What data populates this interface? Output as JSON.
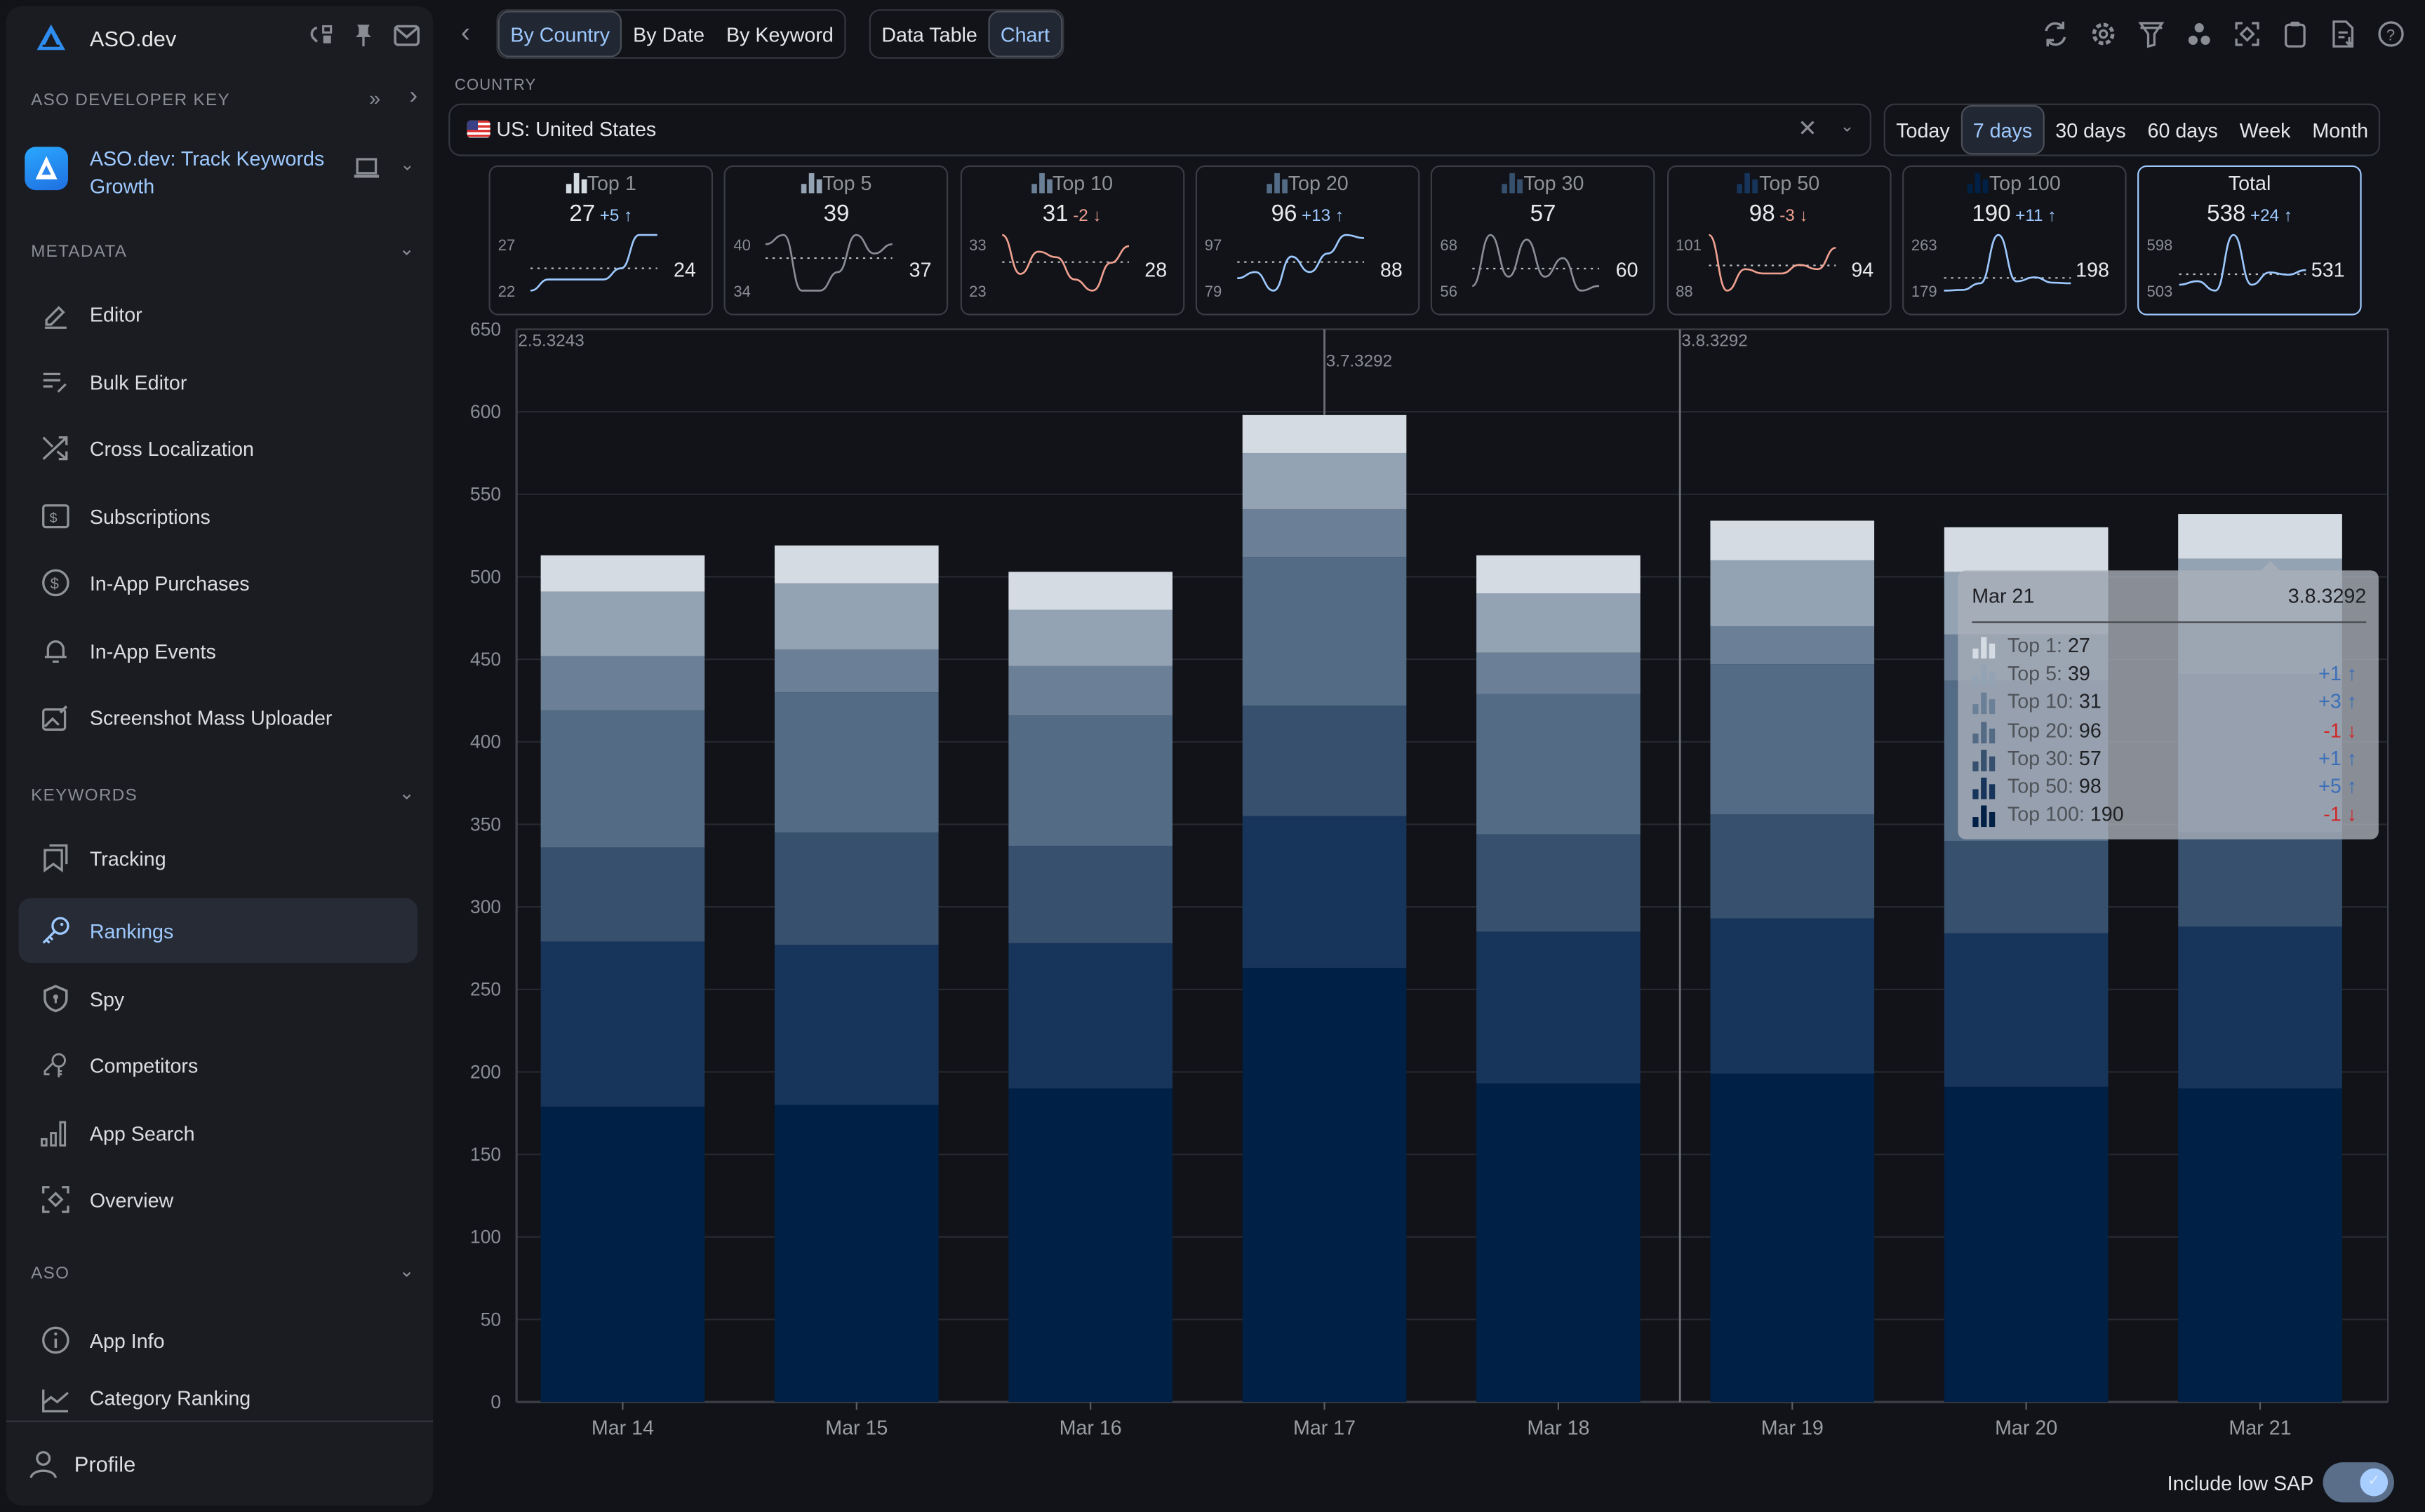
{
  "sidebar": {
    "brand": "ASO.dev",
    "developer_key_label": "ASO DEVELOPER KEY",
    "app_name": "ASO.dev: Track Keywords Growth",
    "sections": [
      {
        "label": "METADATA",
        "items": [
          {
            "label": "Editor",
            "icon": "pencil-icon"
          },
          {
            "label": "Bulk Editor",
            "icon": "bulk-edit-icon"
          },
          {
            "label": "Cross Localization",
            "icon": "shuffle-icon"
          },
          {
            "label": "Subscriptions",
            "icon": "subscription-icon"
          },
          {
            "label": "In-App Purchases",
            "icon": "dollar-circle-icon"
          },
          {
            "label": "In-App Events",
            "icon": "bell-icon"
          },
          {
            "label": "Screenshot Mass Uploader",
            "icon": "image-edit-icon"
          }
        ]
      },
      {
        "label": "KEYWORDS",
        "items": [
          {
            "label": "Tracking",
            "icon": "bookmarks-icon"
          },
          {
            "label": "Rankings",
            "icon": "key-icon",
            "active": true
          },
          {
            "label": "Spy",
            "icon": "shield-lock-icon"
          },
          {
            "label": "Competitors",
            "icon": "keys-icon"
          },
          {
            "label": "App Search",
            "icon": "bar-chart-icon"
          },
          {
            "label": "Overview",
            "icon": "focus-icon"
          }
        ]
      },
      {
        "label": "ASO",
        "items": [
          {
            "label": "App Info",
            "icon": "info-icon"
          },
          {
            "label": "Category Ranking",
            "icon": "trend-icon"
          }
        ]
      }
    ],
    "profile_label": "Profile"
  },
  "toolbar": {
    "group_tabs": [
      {
        "label": "By Country",
        "selected": true
      },
      {
        "label": "By Date",
        "selected": false
      },
      {
        "label": "By Keyword",
        "selected": false
      }
    ],
    "view_tabs": [
      {
        "label": "Data Table",
        "selected": false
      },
      {
        "label": "Chart",
        "selected": true
      }
    ],
    "icons": [
      "refresh-icon",
      "settings-icon",
      "filter-icon",
      "cluster-icon",
      "focus-icon",
      "clipboard-icon",
      "export-icon",
      "help-icon"
    ]
  },
  "country": {
    "label": "COUNTRY",
    "value": "US: United States"
  },
  "ranges": [
    {
      "label": "Today",
      "selected": false
    },
    {
      "label": "7 days",
      "selected": true
    },
    {
      "label": "30 days",
      "selected": false
    },
    {
      "label": "60 days",
      "selected": false
    },
    {
      "label": "Week",
      "selected": false
    },
    {
      "label": "Month",
      "selected": false
    }
  ],
  "cards": [
    {
      "title": "Top 1",
      "value": "27",
      "delta": "+5 ↑",
      "dir": "up",
      "max": "27",
      "min": "22",
      "avg": "24",
      "color": "#d4dbe2",
      "trend": [
        22,
        23,
        23,
        23,
        23,
        24,
        27,
        27
      ]
    },
    {
      "title": "Top 5",
      "value": "39",
      "delta": "",
      "dir": "flat",
      "max": "40",
      "min": "34",
      "avg": "37",
      "color": "#94a3b4",
      "trend": [
        39,
        40,
        34,
        34,
        36,
        40,
        38,
        39
      ]
    },
    {
      "title": "Top 10",
      "value": "31",
      "delta": "-2 ↓",
      "dir": "down",
      "max": "33",
      "min": "23",
      "avg": "28",
      "color": "#6b8097",
      "trend": [
        33,
        26,
        30,
        29,
        25,
        23,
        28,
        31
      ]
    },
    {
      "title": "Top 20",
      "value": "96",
      "delta": "+13 ↑",
      "dir": "up",
      "max": "97",
      "min": "79",
      "avg": "88",
      "color": "#546b85",
      "trend": [
        83,
        85,
        79,
        90,
        85,
        91,
        97,
        96
      ]
    },
    {
      "title": "Top 30",
      "value": "57",
      "delta": "",
      "dir": "flat",
      "max": "68",
      "min": "56",
      "avg": "60",
      "color": "#36506e",
      "trend": [
        57,
        68,
        59,
        67,
        59,
        63,
        56,
        57
      ]
    },
    {
      "title": "Top 50",
      "value": "98",
      "delta": "-3 ↓",
      "dir": "down",
      "max": "101",
      "min": "88",
      "avg": "94",
      "color": "#17345a",
      "trend": [
        101,
        88,
        93,
        92,
        92,
        94,
        93,
        98
      ]
    },
    {
      "title": "Top 100",
      "value": "190",
      "delta": "+11 ↑",
      "dir": "up",
      "max": "263",
      "min": "179",
      "avg": "198",
      "color": "#002046",
      "trend": [
        179,
        180,
        190,
        263,
        193,
        199,
        191,
        190
      ]
    },
    {
      "title": "Total",
      "value": "538",
      "delta": "+24 ↑",
      "dir": "up",
      "max": "598",
      "min": "503",
      "avg": "531",
      "color": "",
      "trend": [
        513,
        519,
        503,
        598,
        513,
        534,
        530,
        538
      ],
      "selected": true
    }
  ],
  "chart_data": {
    "type": "bar",
    "stacked": true,
    "categories": [
      "Mar 14",
      "Mar 15",
      "Mar 16",
      "Mar 17",
      "Mar 18",
      "Mar 19",
      "Mar 20",
      "Mar 21"
    ],
    "series": [
      {
        "name": "Top 100",
        "color": "#002046",
        "values": [
          179,
          180,
          190,
          263,
          193,
          199,
          191,
          190
        ]
      },
      {
        "name": "Top 50",
        "color": "#17345a",
        "values": [
          100,
          97,
          88,
          92,
          92,
          94,
          93,
          98
        ]
      },
      {
        "name": "Top 30",
        "color": "#36506e",
        "values": [
          57,
          68,
          59,
          67,
          59,
          63,
          56,
          57
        ]
      },
      {
        "name": "Top 20",
        "color": "#546b85",
        "values": [
          83,
          85,
          79,
          90,
          85,
          91,
          97,
          96
        ]
      },
      {
        "name": "Top 10",
        "color": "#6b8097",
        "values": [
          33,
          26,
          30,
          29,
          25,
          23,
          28,
          31
        ]
      },
      {
        "name": "Top 5",
        "color": "#94a3b4",
        "values": [
          39,
          40,
          34,
          34,
          36,
          40,
          38,
          39
        ]
      },
      {
        "name": "Top 1",
        "color": "#d4dbe2",
        "values": [
          22,
          23,
          23,
          23,
          23,
          24,
          27,
          27
        ]
      }
    ],
    "ylim": [
      0,
      650
    ],
    "yticks": [
      0,
      50,
      100,
      150,
      200,
      250,
      300,
      350,
      400,
      450,
      500,
      550,
      600,
      650
    ],
    "grid": true,
    "version_markers": [
      {
        "label": "2.5.3243",
        "at": "Mar 14",
        "position": "start"
      },
      {
        "label": "3.7.3292",
        "at": "Mar 17",
        "position": "center"
      },
      {
        "label": "3.8.3292",
        "at": "Mar 19",
        "position": "start"
      }
    ],
    "xlabel": "",
    "ylabel": "",
    "title": ""
  },
  "tooltip": {
    "date": "Mar 21",
    "version": "3.8.3292",
    "rows": [
      {
        "label": "Top 1:",
        "value": "27",
        "delta": "",
        "dir": "",
        "color": "#d4dbe2"
      },
      {
        "label": "Top 5:",
        "value": "39",
        "delta": "+1 ↑",
        "dir": "up",
        "color": "#94a3b4"
      },
      {
        "label": "Top 10:",
        "value": "31",
        "delta": "+3 ↑",
        "dir": "up",
        "color": "#6b8097"
      },
      {
        "label": "Top 20:",
        "value": "96",
        "delta": "-1 ↓",
        "dir": "down",
        "color": "#546b85"
      },
      {
        "label": "Top 30:",
        "value": "57",
        "delta": "+1 ↑",
        "dir": "up",
        "color": "#36506e"
      },
      {
        "label": "Top 50:",
        "value": "98",
        "delta": "+5 ↑",
        "dir": "up",
        "color": "#17345a"
      },
      {
        "label": "Top 100:",
        "value": "190",
        "delta": "-1 ↓",
        "dir": "down",
        "color": "#002046"
      }
    ]
  },
  "footer": {
    "include_low_sap_label": "Include low SAP",
    "include_low_sap": true
  }
}
